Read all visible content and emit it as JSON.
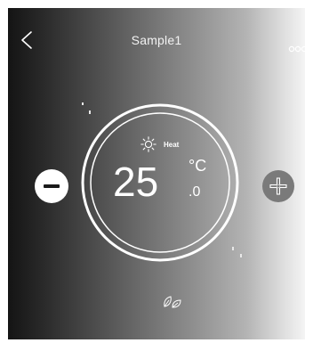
{
  "header": {
    "title": "Sample1"
  },
  "thermostat": {
    "mode_label": "Heat",
    "temperature": "25",
    "unit": "°C",
    "decimal": ".0"
  },
  "colors": {
    "text": "#ffffff",
    "minus_button_bg": "#ffffff",
    "plus_button_bg": "#7a7a7a"
  },
  "icons": {
    "back": "chevron-left-icon",
    "more": "three-dots-icon",
    "mode": "sun-icon",
    "eco": "leaf-icon",
    "minus": "minus-icon",
    "plus": "plus-icon"
  }
}
